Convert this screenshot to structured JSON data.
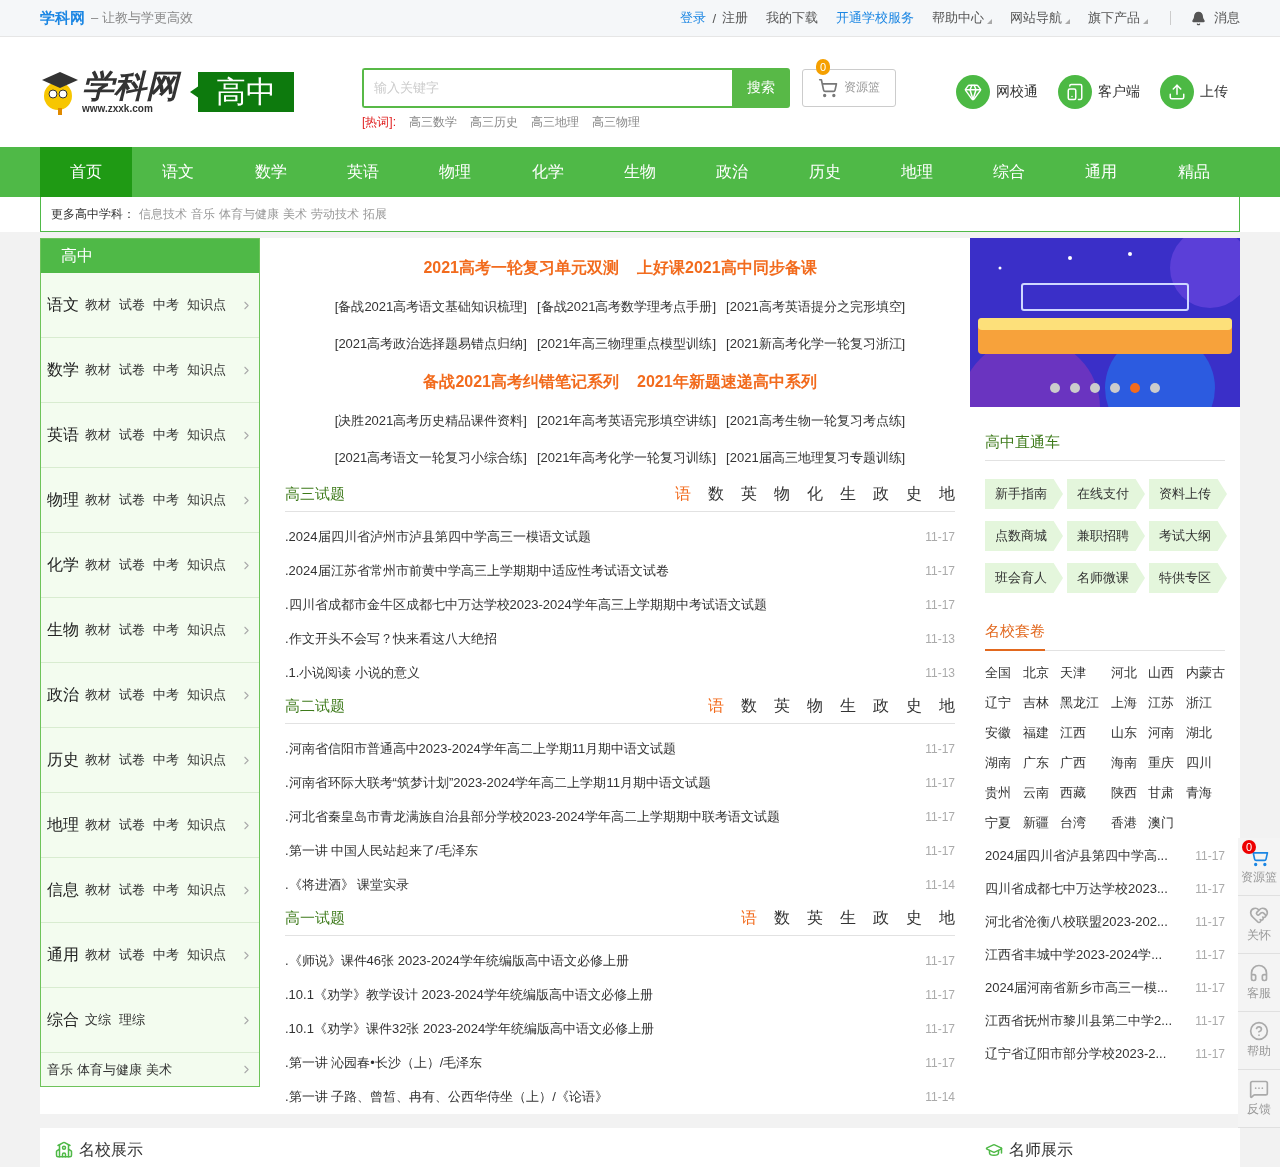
{
  "top_bar": {
    "brand": "学科网",
    "slogan": "– 让教与学更高效",
    "links": [
      {
        "label": "登录",
        "kind": "primary"
      },
      {
        "label": "/",
        "kind": "separator"
      },
      {
        "label": "注册",
        "kind": "plain"
      },
      {
        "label": "我的下载",
        "kind": "plain"
      },
      {
        "label": "开通学校服务",
        "kind": "primary"
      },
      {
        "label": "帮助中心",
        "kind": "menu"
      },
      {
        "label": "网站导航",
        "kind": "menu"
      },
      {
        "label": "旗下产品",
        "kind": "menu"
      }
    ],
    "message": "消息"
  },
  "header": {
    "logo": {
      "name": "学科网",
      "url": "www.zxxk.com"
    },
    "level_badge": "高中",
    "search": {
      "placeholder": "输入关键字",
      "button": "搜索"
    },
    "cart": {
      "count": "0",
      "label": "资源篮"
    },
    "hot_words": {
      "label": "[热词]:",
      "items": [
        "高三数学",
        "高三历史",
        "高三地理",
        "高三物理"
      ]
    },
    "quick_links": [
      {
        "label": "网校通",
        "kind": "gem"
      },
      {
        "label": "客户端",
        "kind": "tablet"
      },
      {
        "label": "上传",
        "kind": "upload"
      }
    ]
  },
  "nav": [
    {
      "label": "首页",
      "selected": true
    },
    {
      "label": "语文",
      "selected": false
    },
    {
      "label": "数学",
      "selected": false
    },
    {
      "label": "英语",
      "selected": false
    },
    {
      "label": "物理",
      "selected": false
    },
    {
      "label": "化学",
      "selected": false
    },
    {
      "label": "生物",
      "selected": false
    },
    {
      "label": "政治",
      "selected": false
    },
    {
      "label": "历史",
      "selected": false
    },
    {
      "label": "地理",
      "selected": false
    },
    {
      "label": "综合",
      "selected": false
    },
    {
      "label": "通用",
      "selected": false
    },
    {
      "label": "精品",
      "selected": false
    }
  ],
  "more_subjects": {
    "label": "更多高中学科：",
    "items": [
      "信息技术",
      "音乐",
      "体育与健康",
      "美术",
      "劳动技术",
      "拓展"
    ]
  },
  "sidebar": {
    "title": "高中",
    "rows": [
      {
        "kind": "subject",
        "subject": "语文",
        "links": [
          "教材",
          "试卷",
          "中考",
          "知识点"
        ]
      },
      {
        "kind": "subject",
        "subject": "数学",
        "links": [
          "教材",
          "试卷",
          "中考",
          "知识点"
        ]
      },
      {
        "kind": "subject",
        "subject": "英语",
        "links": [
          "教材",
          "试卷",
          "中考",
          "知识点"
        ]
      },
      {
        "kind": "subject",
        "subject": "物理",
        "links": [
          "教材",
          "试卷",
          "中考",
          "知识点"
        ]
      },
      {
        "kind": "subject",
        "subject": "化学",
        "links": [
          "教材",
          "试卷",
          "中考",
          "知识点"
        ]
      },
      {
        "kind": "subject",
        "subject": "生物",
        "links": [
          "教材",
          "试卷",
          "中考",
          "知识点"
        ]
      },
      {
        "kind": "subject",
        "subject": "政治",
        "links": [
          "教材",
          "试卷",
          "中考",
          "知识点"
        ]
      },
      {
        "kind": "subject",
        "subject": "历史",
        "links": [
          "教材",
          "试卷",
          "中考",
          "知识点"
        ]
      },
      {
        "kind": "subject",
        "subject": "地理",
        "links": [
          "教材",
          "试卷",
          "中考",
          "知识点"
        ]
      },
      {
        "kind": "subject",
        "subject": "信息",
        "links": [
          "教材",
          "试卷",
          "中考",
          "知识点"
        ]
      },
      {
        "kind": "subject",
        "subject": "通用",
        "links": [
          "教材",
          "试卷",
          "中考",
          "知识点"
        ]
      },
      {
        "kind": "subject",
        "subject": "综合",
        "links": [
          "文综",
          "理综"
        ]
      },
      {
        "kind": "links",
        "links": [
          "音乐",
          "体育与健康",
          "美术"
        ]
      }
    ]
  },
  "featured": [
    {
      "kind": "headline",
      "items": [
        "2021高考一轮复习单元双测",
        "上好课2021高中同步备课"
      ]
    },
    {
      "kind": "links",
      "items": [
        "[备战2021高考语文基础知识梳理]",
        "[备战2021高考数学理考点手册]",
        "[2021高考英语提分之完形填空]"
      ]
    },
    {
      "kind": "links",
      "items": [
        "[2021高考政治选择题易错点归纳]",
        "[2021年高三物理重点模型训练]",
        "[2021新高考化学一轮复习浙江]"
      ]
    },
    {
      "kind": "headline",
      "items": [
        "备战2021高考纠错笔记系列",
        "2021年新题速递高中系列"
      ]
    },
    {
      "kind": "links",
      "items": [
        "[决胜2021高考历史精品课件资料]",
        "[2021年高考英语完形填空讲练]",
        "[2021高考生物一轮复习考点练]"
      ]
    },
    {
      "kind": "links",
      "items": [
        "[2021高考语文一轮复习小综合练]",
        "[2021年高考化学一轮复习训练]",
        "[2021届高三地理复习专题训练]"
      ]
    }
  ],
  "sections": [
    {
      "title": "高三试题",
      "tabs": [
        {
          "label": "语",
          "selected": true
        },
        {
          "label": "数",
          "selected": false
        },
        {
          "label": "英",
          "selected": false
        },
        {
          "label": "物",
          "selected": false
        },
        {
          "label": "化",
          "selected": false
        },
        {
          "label": "生",
          "selected": false
        },
        {
          "label": "政",
          "selected": false
        },
        {
          "label": "史",
          "selected": false
        },
        {
          "label": "地",
          "selected": false
        }
      ],
      "items": [
        {
          "title": ".2024届四川省泸州市泸县第四中学高三一模语文试题",
          "date": "11-17"
        },
        {
          "title": ".2024届江苏省常州市前黄中学高三上学期期中适应性考试语文试卷",
          "date": "11-17"
        },
        {
          "title": ".四川省成都市金牛区成都七中万达学校2023-2024学年高三上学期期中考试语文试题",
          "date": "11-17"
        },
        {
          "title": ".作文开头不会写？快来看这八大绝招",
          "date": "11-13"
        },
        {
          "title": ".1.小说阅读 小说的意义",
          "date": "11-13"
        }
      ]
    },
    {
      "title": "高二试题",
      "tabs": [
        {
          "label": "语",
          "selected": true
        },
        {
          "label": "数",
          "selected": false
        },
        {
          "label": "英",
          "selected": false
        },
        {
          "label": "物",
          "selected": false
        },
        {
          "label": "生",
          "selected": false
        },
        {
          "label": "政",
          "selected": false
        },
        {
          "label": "史",
          "selected": false
        },
        {
          "label": "地",
          "selected": false
        }
      ],
      "items": [
        {
          "title": ".河南省信阳市普通高中2023-2024学年高二上学期11月期中语文试题",
          "date": "11-17"
        },
        {
          "title": ".河南省环际大联考“筑梦计划”2023-2024学年高二上学期11月期中语文试题",
          "date": "11-17"
        },
        {
          "title": ".河北省秦皇岛市青龙满族自治县部分学校2023-2024学年高二上学期期中联考语文试题",
          "date": "11-17"
        },
        {
          "title": ".第一讲 中国人民站起来了/毛泽东",
          "date": "11-17"
        },
        {
          "title": ".《将进酒》 课堂实录",
          "date": "11-14"
        }
      ]
    },
    {
      "title": "高一试题",
      "tabs": [
        {
          "label": "语",
          "selected": true
        },
        {
          "label": "数",
          "selected": false
        },
        {
          "label": "英",
          "selected": false
        },
        {
          "label": "生",
          "selected": false
        },
        {
          "label": "政",
          "selected": false
        },
        {
          "label": "史",
          "selected": false
        },
        {
          "label": "地",
          "selected": false
        }
      ],
      "items": [
        {
          "title": ".《师说》课件46张 2023-2024学年统编版高中语文必修上册",
          "date": "11-17"
        },
        {
          "title": ".10.1《劝学》教学设计 2023-2024学年统编版高中语文必修上册",
          "date": "11-17"
        },
        {
          "title": ".10.1《劝学》课件32张 2023-2024学年统编版高中语文必修上册",
          "date": "11-17"
        },
        {
          "title": ".第一讲 沁园春•长沙（上）/毛泽东",
          "date": "11-17"
        },
        {
          "title": ".第一讲 子路、曾皙、冉有、公西华侍坐（上）/《论语》",
          "date": "11-14"
        }
      ]
    }
  ],
  "banner": {
    "kind": "picture",
    "dots": [
      {
        "selected": false
      },
      {
        "selected": false
      },
      {
        "selected": false
      },
      {
        "selected": false
      },
      {
        "selected": true
      },
      {
        "selected": false
      }
    ]
  },
  "shortcuts": {
    "title": "高中直通车",
    "items": [
      "新手指南",
      "在线支付",
      "资料上传",
      "点数商城",
      "兼职招聘",
      "考试大纲",
      "班会育人",
      "名师微课",
      "特供专区"
    ]
  },
  "famous_papers": {
    "title": "名校套卷",
    "regions": [
      "全国",
      "北京",
      "天津",
      "河北",
      "山西",
      "内蒙古",
      "辽宁",
      "吉林",
      "黑龙江",
      "上海",
      "江苏",
      "浙江",
      "安徽",
      "福建",
      "江西",
      "山东",
      "河南",
      "湖北",
      "湖南",
      "广东",
      "广西",
      "海南",
      "重庆",
      "四川",
      "贵州",
      "云南",
      "西藏",
      "陕西",
      "甘肃",
      "青海",
      "宁夏",
      "新疆",
      "台湾",
      "香港",
      "澳门"
    ],
    "items": [
      {
        "title": "2024届四川省泸县第四中学高...",
        "date": "11-17"
      },
      {
        "title": "四川省成都七中万达学校2023...",
        "date": "11-17"
      },
      {
        "title": "河北省沧衡八校联盟2023-202...",
        "date": "11-17"
      },
      {
        "title": "江西省丰城中学2023-2024学...",
        "date": "11-17"
      },
      {
        "title": "2024届河南省新乡市高三一模...",
        "date": "11-17"
      },
      {
        "title": "江西省抚州市黎川县第二中学2...",
        "date": "11-17"
      },
      {
        "title": "辽宁省辽阳市部分学校2023-2...",
        "date": "11-17"
      }
    ]
  },
  "float_bar": [
    {
      "label": "资源篮",
      "kind": "cart",
      "badge": "0"
    },
    {
      "label": "关怀",
      "kind": "care"
    },
    {
      "label": "客服",
      "kind": "service"
    },
    {
      "label": "帮助",
      "kind": "help"
    },
    {
      "label": "反馈",
      "kind": "feedback"
    }
  ],
  "bottom_sections": [
    {
      "title": "名校展示",
      "kind": "school"
    },
    {
      "title": "名师展示",
      "kind": "teacher"
    }
  ]
}
